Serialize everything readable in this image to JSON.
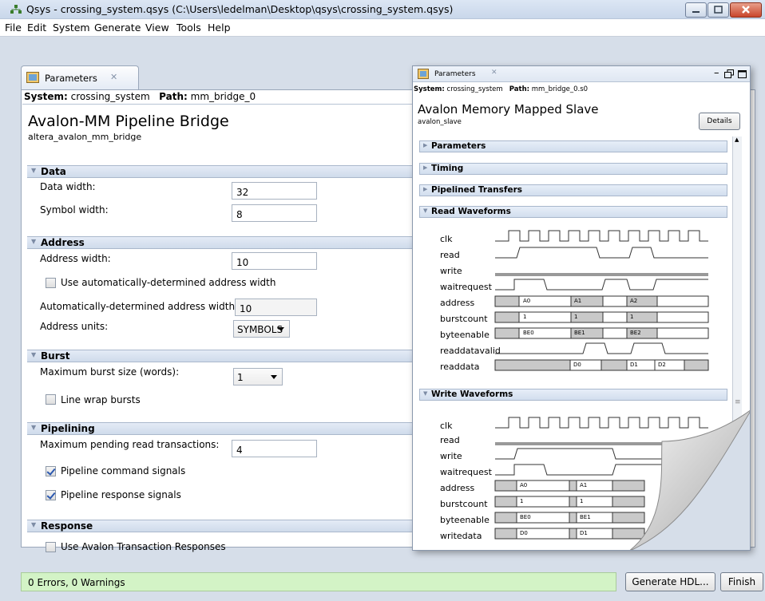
{
  "window": {
    "title": "Qsys - crossing_system.qsys (C:\\Users\\ledelman\\Desktop\\qsys\\crossing_system.qsys)"
  },
  "menu": [
    "File",
    "Edit",
    "System",
    "Generate",
    "View",
    "Tools",
    "Help"
  ],
  "panel": {
    "tab_label": "Parameters",
    "system_label": "System:",
    "system_value": "crossing_system",
    "path_label": "Path:",
    "path_value": "mm_bridge_0",
    "title": "Avalon-MM Pipeline Bridge",
    "subtitle": "altera_avalon_mm_bridge",
    "sections": {
      "data": {
        "label": "Data",
        "data_width_label": "Data width:",
        "data_width_value": "32",
        "symbol_width_label": "Symbol width:",
        "symbol_width_value": "8"
      },
      "address": {
        "label": "Address",
        "address_width_label": "Address width:",
        "address_width_value": "10",
        "auto_checkbox_label": "Use automatically-determined address width",
        "auto_checked": false,
        "auto_width_label": "Automatically-determined address width:",
        "auto_width_value": "10",
        "units_label": "Address units:",
        "units_value": "SYMBOLS"
      },
      "burst": {
        "label": "Burst",
        "max_burst_label": "Maximum burst size (words):",
        "max_burst_value": "1",
        "line_wrap_label": "Line wrap bursts",
        "line_wrap_checked": false
      },
      "pipelining": {
        "label": "Pipelining",
        "max_pending_label": "Maximum pending read transactions:",
        "max_pending_value": "4",
        "cmd_label": "Pipeline command signals",
        "cmd_checked": true,
        "resp_label": "Pipeline response signals",
        "resp_checked": true
      },
      "response": {
        "label": "Response",
        "use_resp_label": "Use Avalon Transaction Responses",
        "use_resp_checked": false
      }
    }
  },
  "float_panel": {
    "tab_label": "Parameters",
    "system_label": "System:",
    "system_value": "crossing_system",
    "path_label": "Path:",
    "path_value": "mm_bridge_0.s0",
    "title": "Avalon Memory Mapped Slave",
    "subtitle": "avalon_slave",
    "details_button": "Details",
    "sections": [
      "Parameters",
      "Timing",
      "Pipelined Transfers",
      "Read Waveforms",
      "Write Waveforms"
    ],
    "read_signals": [
      "clk",
      "read",
      "write",
      "waitrequest",
      "address",
      "burstcount",
      "byteenable",
      "readdatavalid",
      "readdata"
    ],
    "write_signals": [
      "clk",
      "read",
      "write",
      "waitrequest",
      "address",
      "burstcount",
      "byteenable",
      "writedata"
    ],
    "read_bus": {
      "address": [
        "A0",
        "A1",
        "A2"
      ],
      "burstcount": [
        "1",
        "1",
        "1"
      ],
      "byteenable": [
        "BE0",
        "BE1",
        "BE2"
      ],
      "readdata": [
        "D0",
        "D1",
        "D2"
      ]
    },
    "write_bus": {
      "address": [
        "A0",
        "A1"
      ],
      "burstcount": [
        "1",
        "1"
      ],
      "byteenable": [
        "BE0",
        "BE1"
      ],
      "writedata": [
        "D0",
        "D1"
      ]
    }
  },
  "status": {
    "text": "0 Errors, 0 Warnings"
  },
  "buttons": {
    "generate": "Generate HDL...",
    "finish": "Finish"
  }
}
